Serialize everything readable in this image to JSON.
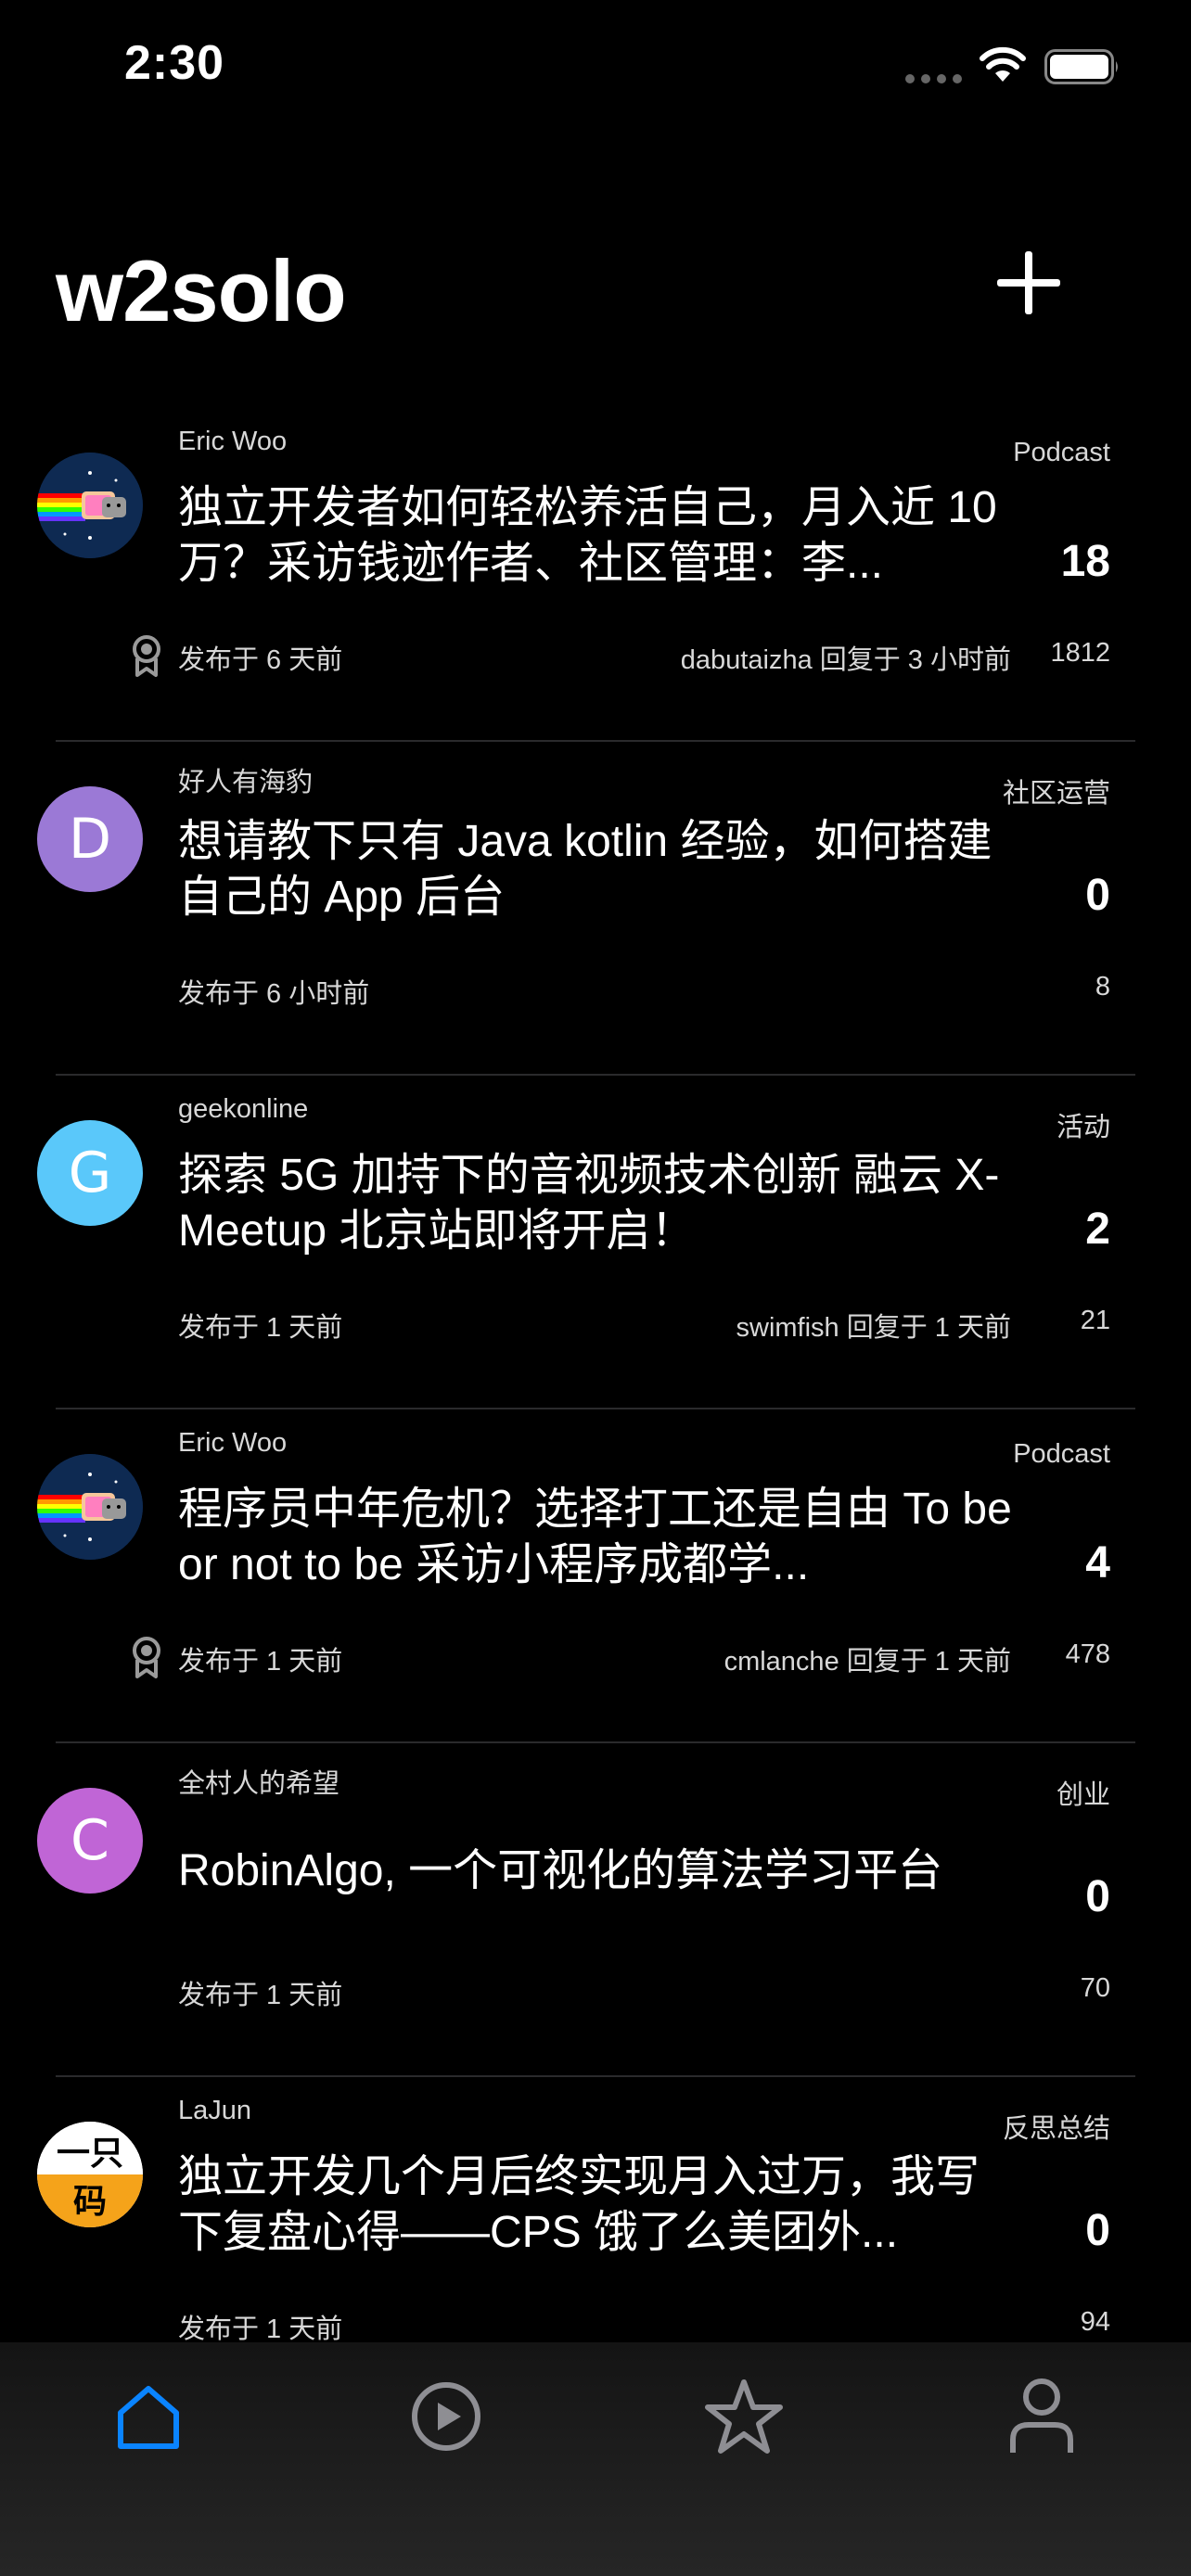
{
  "status_bar": {
    "time": "2:30",
    "icons": [
      "signal-dots-icon",
      "wifi-icon",
      "battery-icon"
    ]
  },
  "header": {
    "title": "w2solo",
    "add_icon": "plus-icon"
  },
  "topics": [
    {
      "author": "Eric Woo",
      "category": "Podcast",
      "title": "独立开发者如何轻松养活自己，月入近 10 万？采访钱迹作者、社区管理：李...",
      "replies": "18",
      "posted": "发布于 6 天前",
      "last_reply": "dabutaizha 回复于 3 小时前",
      "views": "1812",
      "avatar": {
        "type": "nyan-cat"
      },
      "pinned": true
    },
    {
      "author": "好人有海豹",
      "category": "社区运营",
      "title": "想请教下只有 Java kotlin 经验，如何搭建自己的 App 后台",
      "replies": "0",
      "posted": "发布于 6 小时前",
      "last_reply": "",
      "views": "8",
      "avatar": {
        "type": "letter",
        "letter": "D",
        "color": "#9b79d6"
      },
      "pinned": false
    },
    {
      "author": "geekonline",
      "category": "活动",
      "title": "探索 5G 加持下的音视频技术创新 融云 X-Meetup 北京站即将开启！",
      "replies": "2",
      "posted": "发布于 1 天前",
      "last_reply": "swimfish 回复于 1 天前",
      "views": "21",
      "avatar": {
        "type": "letter",
        "letter": "G",
        "color": "#5ac8fa"
      },
      "pinned": false
    },
    {
      "author": "Eric Woo",
      "category": "Podcast",
      "title": "程序员中年危机？选择打工还是自由 To be or not to be 采访小程序成都学...",
      "replies": "4",
      "posted": "发布于 1 天前",
      "last_reply": "cmlanche 回复于 1 天前",
      "views": "478",
      "avatar": {
        "type": "nyan-cat"
      },
      "pinned": true
    },
    {
      "author": "全村人的希望",
      "category": "创业",
      "title": "RobinAlgo, 一个可视化的算法学习平台",
      "replies": "0",
      "posted": "发布于 1 天前",
      "last_reply": "",
      "views": "70",
      "avatar": {
        "type": "letter",
        "letter": "C",
        "color": "#c065d6"
      },
      "pinned": false,
      "single_line": true
    },
    {
      "author": "LaJun",
      "category": "反思总结",
      "title": "独立开发几个月后终实现月入过万，我写下复盘心得——CPS 饿了么美团外...",
      "replies": "0",
      "posted": "发布于 1 天前",
      "last_reply": "",
      "views": "94",
      "avatar": {
        "type": "logo",
        "line1": "一只",
        "line2": "码",
        "color": "#f5a31a"
      },
      "pinned": false
    }
  ],
  "tab_bar": {
    "tabs": [
      {
        "name": "home",
        "icon": "home-icon",
        "active": true
      },
      {
        "name": "video",
        "icon": "play-circle-icon",
        "active": false
      },
      {
        "name": "favorites",
        "icon": "star-icon",
        "active": false
      },
      {
        "name": "profile",
        "icon": "person-icon",
        "active": false
      }
    ],
    "active_color": "#0a84ff",
    "inactive_color": "#8e8e93"
  }
}
